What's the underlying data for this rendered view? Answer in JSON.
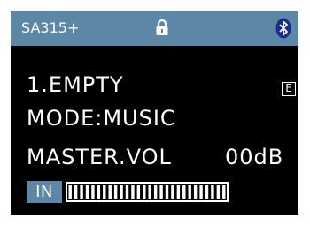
{
  "status_bar": {
    "model": "SA315+",
    "icons": [
      "lock-icon",
      "bluetooth-icon"
    ],
    "background_color": "#5d87a7"
  },
  "main": {
    "preset_label": "1.EMPTY",
    "preset_badge": "E",
    "mode_label": "MODE:MUSIC",
    "master_vol_label": "MASTER.VOL",
    "master_vol_value": "00dB"
  },
  "input_meter": {
    "label": "IN",
    "level_percent": 100
  }
}
